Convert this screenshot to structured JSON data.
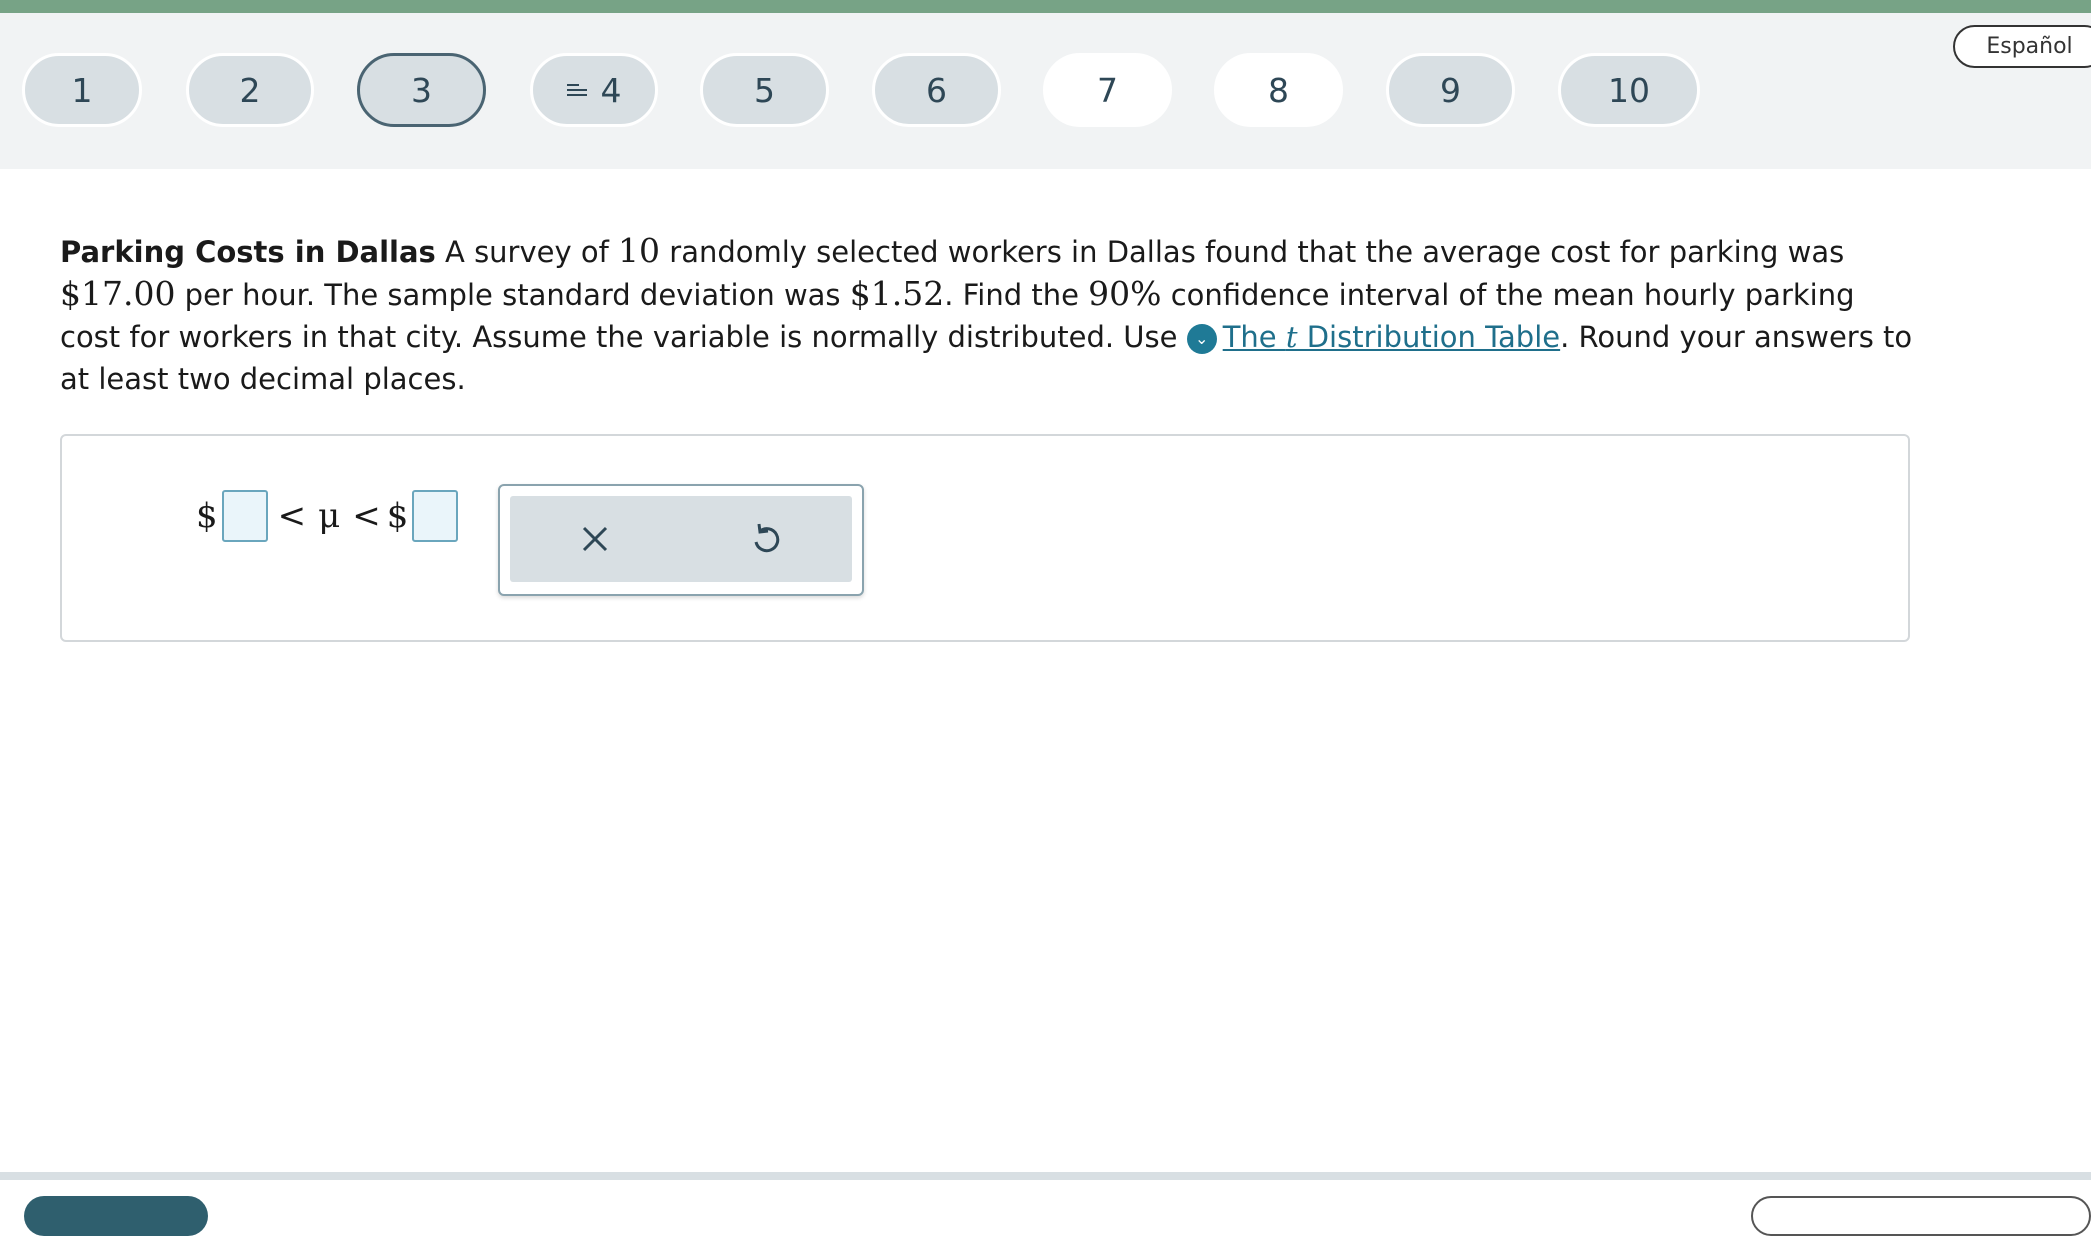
{
  "header": {
    "question_numbers": [
      "1",
      "2",
      "3",
      "4",
      "5",
      "6",
      "7",
      "8",
      "9",
      "10"
    ],
    "current_question": "3",
    "language_button": "Español"
  },
  "question": {
    "title": "Parking Costs in Dallas",
    "t1": " A survey of ",
    "n": "10",
    "t2": " randomly selected workers in Dallas found that the average cost for parking was ",
    "mean": "$17.00",
    "t3": " per hour. The sample standard deviation was ",
    "sd": "$1.52",
    "t4": ". Find the ",
    "conf": "90%",
    "t5": " confidence interval of the mean hourly parking cost for workers in that city. Assume the variable is normally distributed. Use ",
    "link_pre": "The ",
    "link_t": "t",
    "link_post": " Distribution Table",
    "t6": ". Round your answers to at least two decimal places."
  },
  "answer": {
    "dollar1": "$",
    "lt1": "<",
    "mu": "μ",
    "lt2": "<",
    "dollar2": "$"
  },
  "tools": {
    "clear_icon": "×",
    "undo_icon": "undo-icon"
  },
  "colors": {
    "topbar": "#77a386",
    "header_bg": "#f1f3f4",
    "nav_button": "#d8dfe3",
    "link": "#1f6f8b",
    "input_border": "#6aa6bd"
  }
}
